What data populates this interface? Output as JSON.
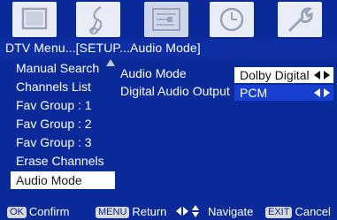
{
  "top_icons": [
    {
      "name": "tv-picture-icon",
      "active": false
    },
    {
      "name": "music-note-icon",
      "active": false
    },
    {
      "name": "channel-setup-icon",
      "active": true
    },
    {
      "name": "clock-icon",
      "active": false
    },
    {
      "name": "wrench-icon",
      "active": false
    }
  ],
  "breadcrumb": "DTV Menu...[SETUP...Audio Mode]",
  "left_menu": {
    "items": [
      {
        "label": "Manual Search"
      },
      {
        "label": "Channels List"
      },
      {
        "label": "Fav Group : 1"
      },
      {
        "label": "Fav Group : 2"
      },
      {
        "label": "Fav Group : 3"
      },
      {
        "label": "Erase Channels"
      },
      {
        "label": "Audio Mode"
      }
    ],
    "selected": "Audio Mode"
  },
  "settings": {
    "audio_mode": {
      "label": "Audio Mode",
      "value": "Dolby Digital"
    },
    "digital_audio_output": {
      "label": "Digital Audio Output",
      "value": "PCM"
    }
  },
  "hints": {
    "ok_key": "OK",
    "ok_label": "Confirm",
    "menu_key": "MENU",
    "menu_label": "Return",
    "navigate_label": "Navigate",
    "exit_key": "EXIT",
    "exit_label": "Cancel"
  },
  "colors": {
    "background": "#0b2a9a",
    "selection": "#ffffff",
    "value_field": "#173fd0"
  }
}
